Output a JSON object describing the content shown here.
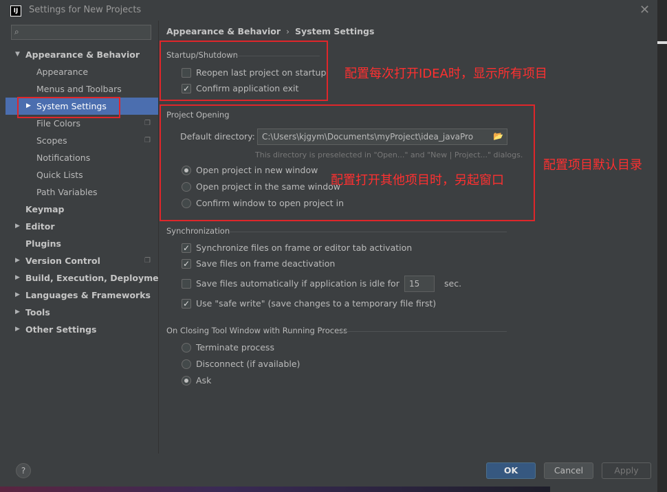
{
  "window": {
    "title": "Settings for New Projects",
    "app_icon_text": "IJ"
  },
  "search": {
    "placeholder": "",
    "value": ""
  },
  "sidebar": {
    "items": [
      {
        "label": "Appearance & Behavior",
        "level": 0,
        "expanded": true
      },
      {
        "label": "Appearance",
        "level": 1
      },
      {
        "label": "Menus and Toolbars",
        "level": 1
      },
      {
        "label": "System Settings",
        "level": 1,
        "selected": true
      },
      {
        "label": "File Colors",
        "level": 1
      },
      {
        "label": "Scopes",
        "level": 1
      },
      {
        "label": "Notifications",
        "level": 1
      },
      {
        "label": "Quick Lists",
        "level": 1
      },
      {
        "label": "Path Variables",
        "level": 1
      },
      {
        "label": "Keymap",
        "level": 0
      },
      {
        "label": "Editor",
        "level": 0
      },
      {
        "label": "Plugins",
        "level": 0
      },
      {
        "label": "Version Control",
        "level": 0
      },
      {
        "label": "Build, Execution, Deployment",
        "level": 0
      },
      {
        "label": "Languages & Frameworks",
        "level": 0
      },
      {
        "label": "Tools",
        "level": 0
      },
      {
        "label": "Other Settings",
        "level": 0
      }
    ]
  },
  "breadcrumb": {
    "parent": "Appearance & Behavior",
    "current": "System Settings"
  },
  "startup": {
    "title": "Startup/Shutdown",
    "reopen_label": "Reopen last project on startup",
    "reopen_checked": false,
    "confirm_label": "Confirm application exit",
    "confirm_checked": true
  },
  "project_opening": {
    "title": "Project Opening",
    "dir_label": "Default directory:",
    "dir_value": "C:\\Users\\kjgym\\Documents\\myProject\\idea_javaPro",
    "hint": "This directory is preselected in \"Open...\" and \"New | Project...\" dialogs.",
    "options": [
      {
        "label": "Open project in new window",
        "selected": true
      },
      {
        "label": "Open project in the same window",
        "selected": false
      },
      {
        "label": "Confirm window to open project in",
        "selected": false
      }
    ]
  },
  "sync": {
    "title": "Synchronization",
    "opt1": "Synchronize files on frame or editor tab activation",
    "opt1_checked": true,
    "opt2": "Save files on frame deactivation",
    "opt2_checked": true,
    "opt3": "Save files automatically if application is idle for",
    "opt3_checked": false,
    "idle_value": "15",
    "idle_unit": "sec.",
    "opt4": "Use \"safe write\" (save changes to a temporary file first)",
    "opt4_checked": true
  },
  "closing": {
    "title": "On Closing Tool Window with Running Process",
    "options": [
      {
        "label": "Terminate process",
        "selected": false
      },
      {
        "label": "Disconnect (if available)",
        "selected": false
      },
      {
        "label": "Ask",
        "selected": true
      }
    ]
  },
  "annotations": {
    "a1": "配置每次打开IDEA时，显示所有项目",
    "a2": "配置打开其他项目时，另起窗口",
    "a3": "配置项目默认目录",
    "color": "#e0262a"
  },
  "footer": {
    "help": "?",
    "ok": "OK",
    "cancel": "Cancel",
    "apply": "Apply"
  }
}
